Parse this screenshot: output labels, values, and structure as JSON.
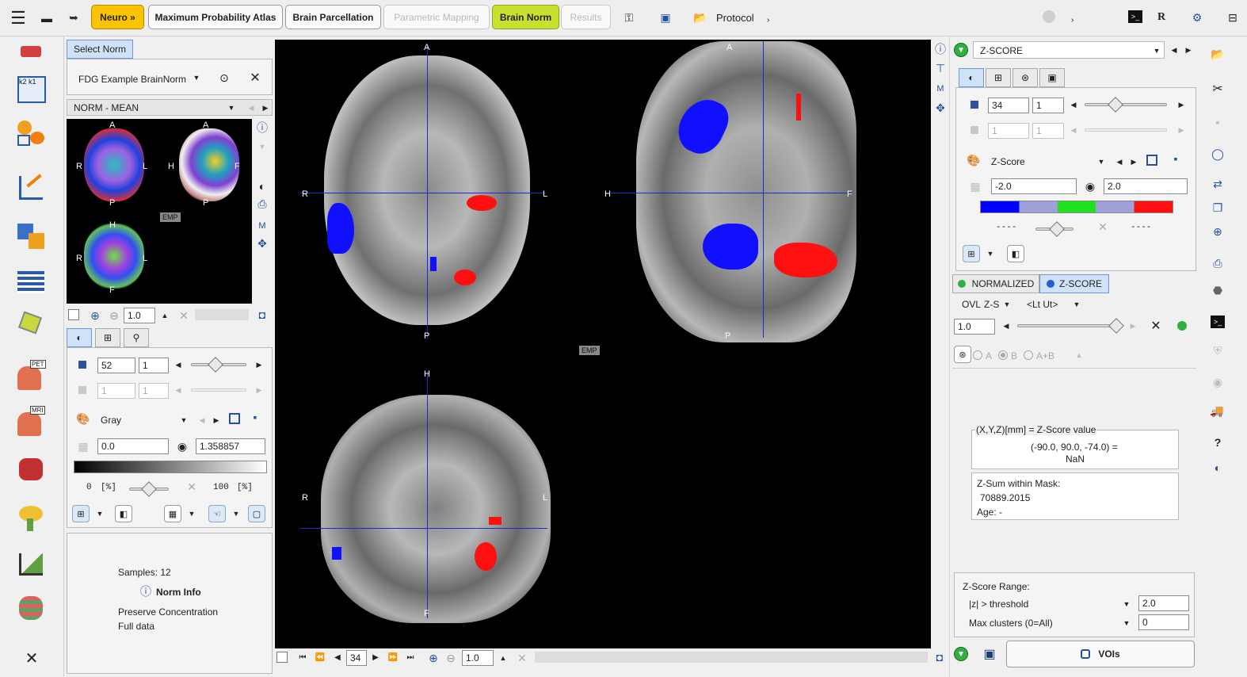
{
  "toolbar": {
    "neuro_label": "Neuro »",
    "map_label": "Maximum Probability Atlas",
    "parc_label": "Brain Parcellation",
    "param_label": "Parametric Mapping",
    "norm_label": "Brain Norm",
    "results_label": "Results",
    "protocol_label": "Protocol",
    "r_label": "R",
    "chev1": "›",
    "chev2": "›"
  },
  "left_panel": {
    "select_tab": "Select Norm",
    "norm_name": "FDG Example BrainNorm",
    "norm_type": "NORM - MEAN",
    "zoom_value": "1.0",
    "emp_label": "EMP",
    "thumb_orient": {
      "a1": "A",
      "r1": "R",
      "l1": "L",
      "p1": "P",
      "a2": "A",
      "h2": "H",
      "f2": "F",
      "p2": "P",
      "h3": "H",
      "r3": "R",
      "l3": "L",
      "f3": "F"
    },
    "slice_value": "52",
    "slice_step": "1",
    "frame_value": "1",
    "frame_step": "1",
    "colortable": "Gray",
    "min_value": "0.0",
    "max_value": "1.358857",
    "pct_min": "0",
    "pct_unit1": "[%]",
    "pct_max": "100",
    "pct_unit2": "[%]",
    "samples": "Samples: 12",
    "norm_info": "Norm Info",
    "preserve": "Preserve Concentration",
    "full_data": "Full data"
  },
  "viewer": {
    "axial": {
      "top": "A",
      "bottom": "P",
      "left": "R",
      "right": "L"
    },
    "sagittal": {
      "top": "A",
      "bottom": "P",
      "left": "H",
      "right": "F"
    },
    "coronal": {
      "top": "H",
      "bottom": "F",
      "left": "R",
      "right": "L"
    },
    "emp_label": "EMP",
    "slice_value": "34",
    "zoom_value": "1.0"
  },
  "right_panel": {
    "map_select": "Z-SCORE",
    "slice_value": "34",
    "slice_step": "1",
    "frame_value": "1",
    "frame_step": "1",
    "colortable": "Z-Score",
    "min_value": "-2.0",
    "max_value": "2.0",
    "dash_left": "----",
    "dash_right": "----",
    "tab_normalized": "NORMALIZED",
    "tab_zscore": "Z-SCORE",
    "ovl_label": "OVL",
    "ovl_z": "Z-S",
    "lt_ut": "<Lt Ut>",
    "fusion_value": "1.0",
    "radio_a": "A",
    "radio_b": "B",
    "radio_ab": "A+B",
    "info_header": "(X,Y,Z)[mm] = Z-Score value",
    "coords": "(-90.0, 90.0, -74.0) =",
    "value": "NaN",
    "zsum_label": "Z-Sum within Mask:",
    "zsum_value": "70889.2015",
    "age_label": "Age: -",
    "range_title": "Z-Score Range:",
    "range_cond": "|z| > threshold",
    "range_value": "2.0",
    "clusters_label": "Max clusters (0=All)",
    "clusters_value": "0",
    "vois_label": "VOIs"
  },
  "colors": {
    "accent_yellow": "#fbc400",
    "accent_green": "#c8e030",
    "crosshair": "#1a2ccc",
    "zscore_pos": "#ff1010",
    "zscore_neg": "#1010ff"
  }
}
